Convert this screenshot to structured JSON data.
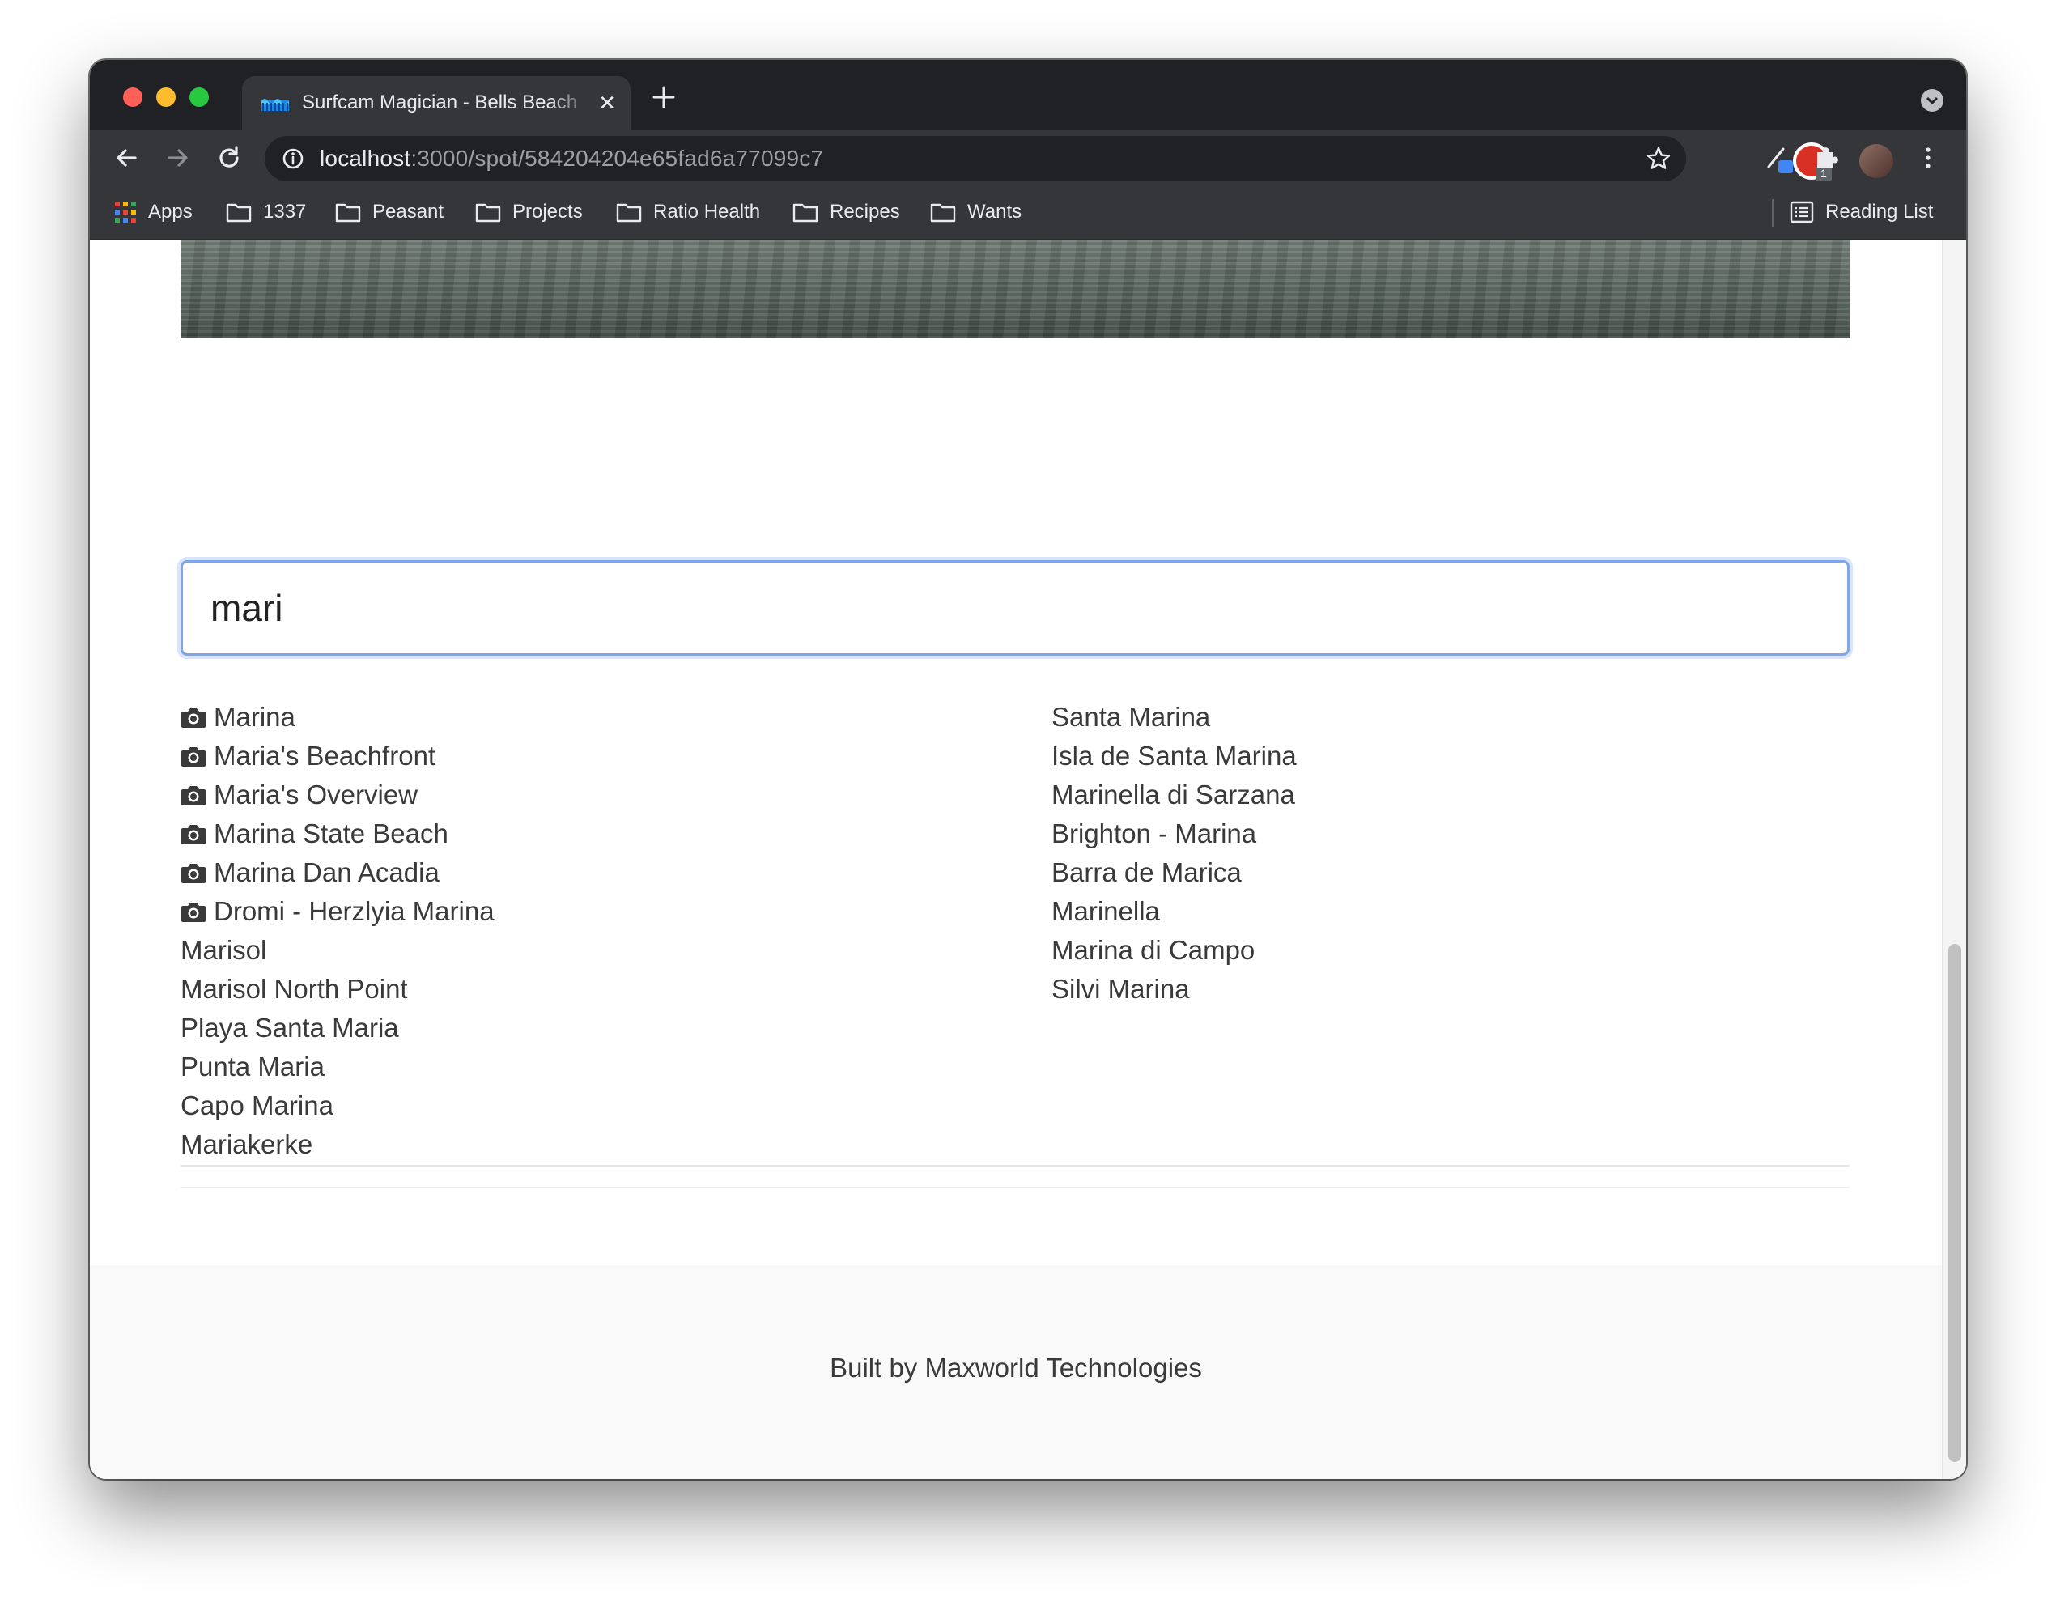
{
  "browser": {
    "tab_title": "Surfcam Magician - Bells Beach",
    "url_host": "localhost",
    "url_rest": ":3000/spot/584204204e65fad6a77099c7",
    "extension_badge": "1",
    "bookmarks": [
      {
        "label": "Apps",
        "icon": "apps-grid-icon"
      },
      {
        "label": "1337",
        "icon": "folder-icon"
      },
      {
        "label": "Peasant",
        "icon": "folder-icon"
      },
      {
        "label": "Projects",
        "icon": "folder-icon"
      },
      {
        "label": "Ratio Health",
        "icon": "folder-icon"
      },
      {
        "label": "Recipes",
        "icon": "folder-icon"
      },
      {
        "label": "Wants",
        "icon": "folder-icon"
      }
    ],
    "reading_list": "Reading List"
  },
  "search": {
    "value": "mari"
  },
  "results": {
    "left": [
      {
        "name": "Marina",
        "has_cam": true
      },
      {
        "name": "Maria's Beachfront",
        "has_cam": true
      },
      {
        "name": "Maria's Overview",
        "has_cam": true
      },
      {
        "name": "Marina State Beach",
        "has_cam": true
      },
      {
        "name": "Marina Dan Acadia",
        "has_cam": true
      },
      {
        "name": "Dromi - Herzlyia Marina",
        "has_cam": true
      },
      {
        "name": "Marisol",
        "has_cam": false
      },
      {
        "name": "Marisol North Point",
        "has_cam": false
      },
      {
        "name": "Playa Santa Maria",
        "has_cam": false
      },
      {
        "name": "Punta Maria",
        "has_cam": false
      },
      {
        "name": "Capo Marina",
        "has_cam": false
      },
      {
        "name": "Mariakerke",
        "has_cam": false
      }
    ],
    "right": [
      {
        "name": "Santa Marina",
        "has_cam": false
      },
      {
        "name": "Isla de Santa Marina",
        "has_cam": false
      },
      {
        "name": "Marinella di Sarzana",
        "has_cam": false
      },
      {
        "name": "Brighton - Marina",
        "has_cam": false
      },
      {
        "name": "Barra de Marica",
        "has_cam": false
      },
      {
        "name": "Marinella",
        "has_cam": false
      },
      {
        "name": "Marina di Campo",
        "has_cam": false
      },
      {
        "name": "Silvi Marina",
        "has_cam": false
      }
    ]
  },
  "footer": {
    "text": "Built by Maxworld Technologies"
  }
}
